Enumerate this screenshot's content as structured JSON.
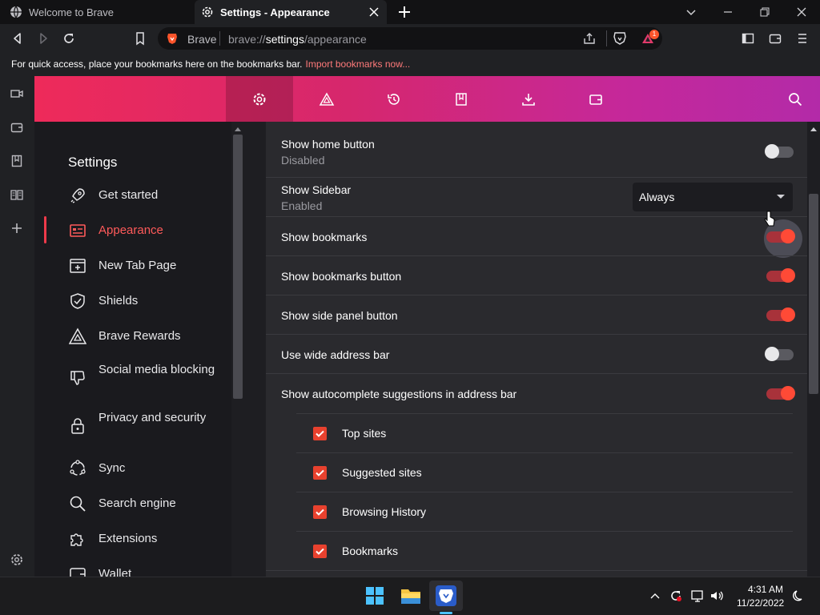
{
  "tabs": [
    {
      "title": "Welcome to Brave",
      "icon": "globe-icon",
      "active": false
    },
    {
      "title": "Settings - Appearance",
      "icon": "settings-gear-icon",
      "active": true
    }
  ],
  "omnibox": {
    "site_label": "Brave",
    "url_prefix": "brave://",
    "url_host": "settings",
    "url_path": "/appearance",
    "rewards_badge": "1"
  },
  "bookmarks_bar": {
    "message": "For quick access, place your bookmarks here on the bookmarks bar.",
    "link": "Import bookmarks now..."
  },
  "settings_nav": {
    "title": "Settings",
    "items": [
      {
        "label": "Get started",
        "icon": "rocket-icon"
      },
      {
        "label": "Appearance",
        "icon": "appearance-icon",
        "active": true
      },
      {
        "label": "New Tab Page",
        "icon": "new-tab-page-icon"
      },
      {
        "label": "Shields",
        "icon": "shield-icon"
      },
      {
        "label": "Brave Rewards",
        "icon": "rewards-triangle-icon"
      },
      {
        "label": "Social media blocking",
        "icon": "thumbs-down-icon"
      },
      {
        "label": "Privacy and security",
        "icon": "lock-icon"
      },
      {
        "label": "Sync",
        "icon": "sync-icon"
      },
      {
        "label": "Search engine",
        "icon": "search-icon"
      },
      {
        "label": "Extensions",
        "icon": "puzzle-icon"
      },
      {
        "label": "Wallet",
        "icon": "wallet-icon"
      }
    ]
  },
  "appearance": {
    "rows": [
      {
        "label": "Show home button",
        "sublabel": "Disabled",
        "toggle": false
      },
      {
        "label": "Show Sidebar",
        "sublabel": "Enabled",
        "select_value": "Always"
      },
      {
        "label": "Show bookmarks",
        "toggle": true
      },
      {
        "label": "Show bookmarks button",
        "toggle": true
      },
      {
        "label": "Show side panel button",
        "toggle": true
      },
      {
        "label": "Use wide address bar",
        "toggle": false
      },
      {
        "label": "Show autocomplete suggestions in address bar",
        "toggle": true
      }
    ],
    "autocomplete_options": [
      {
        "label": "Top sites",
        "checked": true
      },
      {
        "label": "Suggested sites",
        "checked": true
      },
      {
        "label": "Browsing History",
        "checked": true
      },
      {
        "label": "Bookmarks",
        "checked": true
      }
    ]
  },
  "taskbar": {
    "time": "4:31 AM",
    "date": "11/22/2022"
  },
  "colors": {
    "accent": "#ff4a36",
    "header_gradient_start": "#ee2a5a",
    "header_gradient_end": "#b32aa8"
  }
}
